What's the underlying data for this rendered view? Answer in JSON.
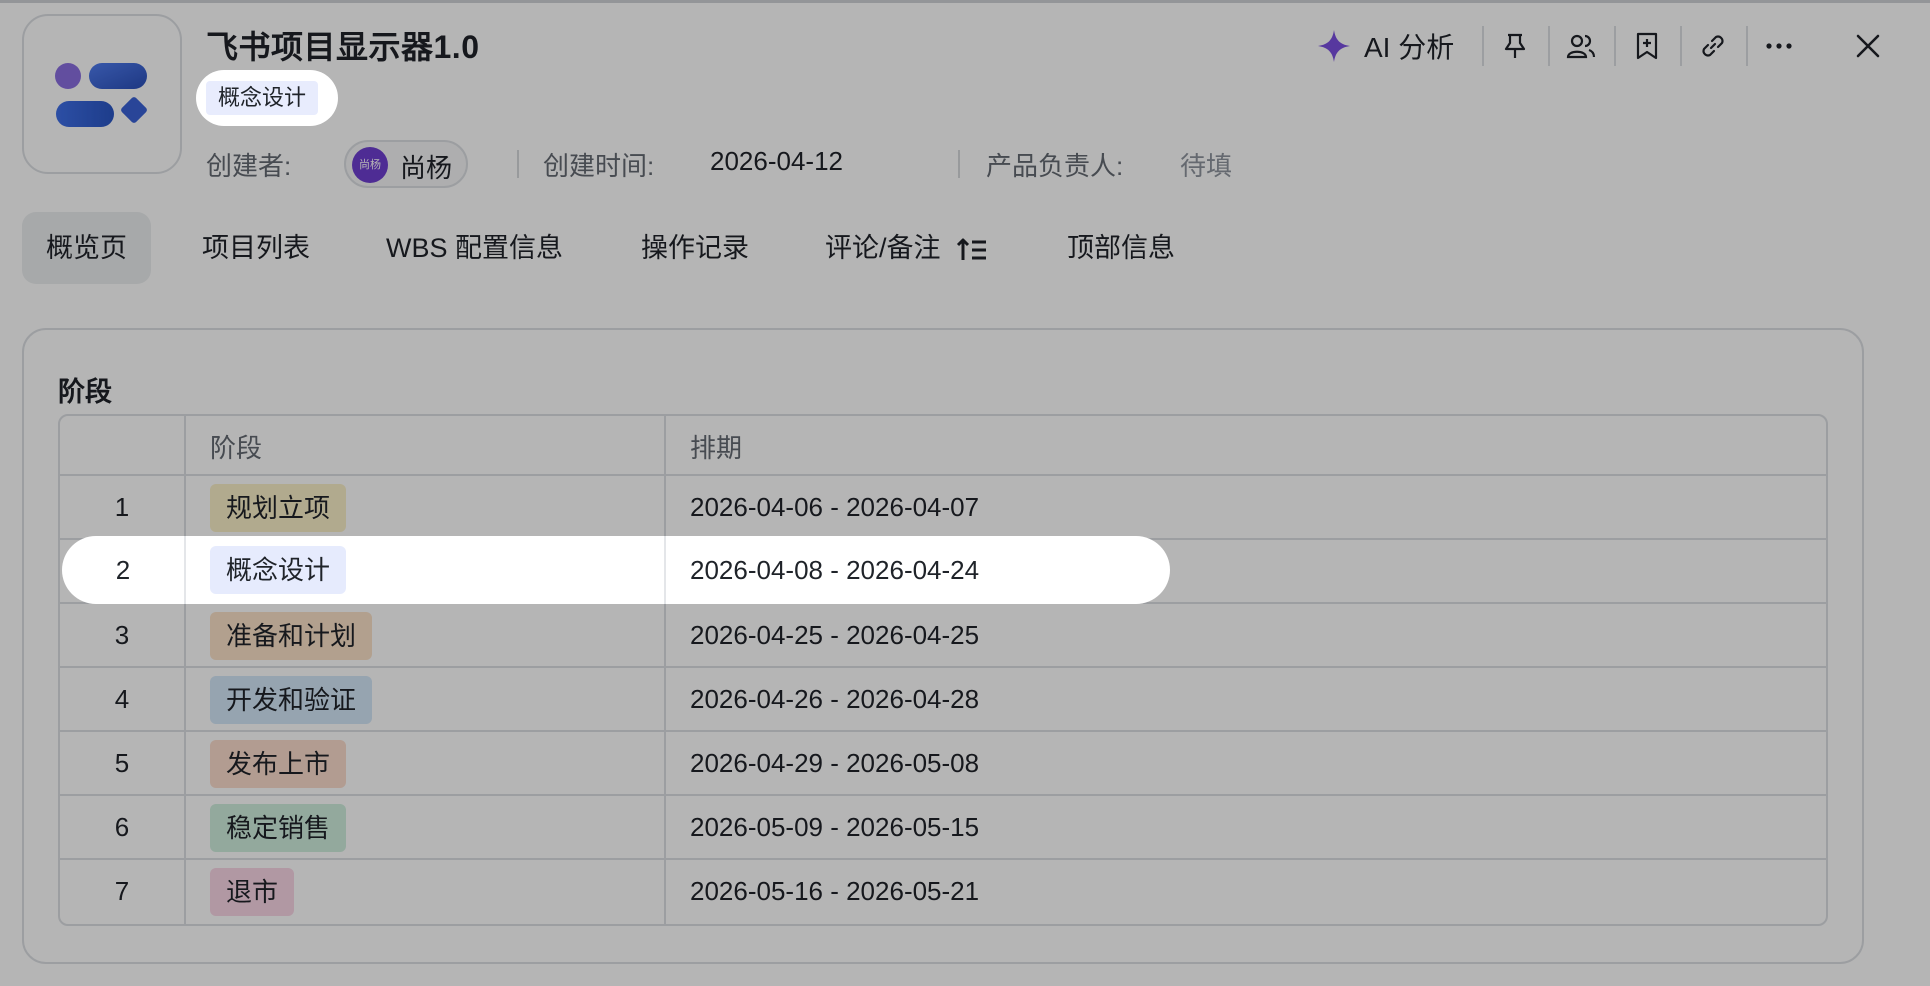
{
  "header": {
    "title": "飞书项目显示器1.0",
    "stage_tag": "概念设计",
    "creator_label": "创建者:",
    "creator_name": "尚杨",
    "creator_avatar_text": "尚杨",
    "created_label": "创建时间:",
    "created_value": "2026-04-12",
    "owner_label": "产品负责人:",
    "owner_value": "待填"
  },
  "toolbar": {
    "ai_label": "AI 分析",
    "icons": [
      "pin-icon",
      "members-icon",
      "bookmark-add-icon",
      "link-icon",
      "more-icon",
      "close-icon"
    ]
  },
  "tabs": [
    {
      "label": "概览页",
      "active": true
    },
    {
      "label": "项目列表"
    },
    {
      "label": "WBS 配置信息"
    },
    {
      "label": "操作记录"
    },
    {
      "label": "评论/备注"
    },
    {
      "label": "顶部信息"
    }
  ],
  "stages_section": {
    "title": "阶段",
    "columns": [
      "",
      "阶段",
      "排期"
    ],
    "rows": [
      {
        "index": "1",
        "stage": "规划立项",
        "range": "2026-04-06 - 2026-04-07",
        "color": "#faf0c8"
      },
      {
        "index": "2",
        "stage": "概念设计",
        "range": "2026-04-08 - 2026-04-24",
        "color": "#e6ebfd"
      },
      {
        "index": "3",
        "stage": "准备和计划",
        "range": "2026-04-25 - 2026-04-25",
        "color": "#fbe2c8"
      },
      {
        "index": "4",
        "stage": "开发和验证",
        "range": "2026-04-26 - 2026-04-28",
        "color": "#d3e7f8"
      },
      {
        "index": "5",
        "stage": "发布上市",
        "range": "2026-04-29 - 2026-05-08",
        "color": "#fbdccc"
      },
      {
        "index": "6",
        "stage": "稳定销售",
        "range": "2026-05-09 - 2026-05-15",
        "color": "#cfeedd"
      },
      {
        "index": "7",
        "stage": "退市",
        "range": "2026-05-16 - 2026-05-21",
        "color": "#fad6e6"
      }
    ]
  },
  "colors": {
    "accent_purple": "#6f3fd1",
    "ai_sparkle": "#7b4fe0",
    "overlay": "rgba(0,0,0,0.29)"
  }
}
